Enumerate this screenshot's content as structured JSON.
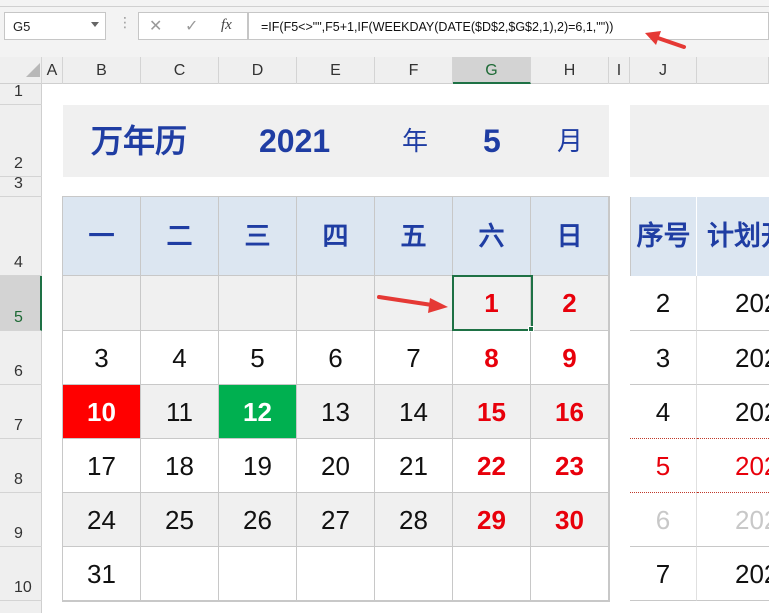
{
  "formula_bar": {
    "name_box": "G5",
    "cancel_icon": "✕",
    "enter_icon": "✓",
    "function_icon": "fx",
    "formula": "=IF(F5<>\"\",F5+1,IF(WEEKDAY(DATE($D$2,$G$2,1),2)=6,1,\"\"))"
  },
  "columns": [
    "A",
    "B",
    "C",
    "D",
    "E",
    "F",
    "G",
    "H",
    "I",
    "J"
  ],
  "rows": [
    "1",
    "2",
    "3",
    "4",
    "5",
    "6",
    "7",
    "8",
    "9",
    "10"
  ],
  "selected_cell": {
    "column": "G",
    "row": "5"
  },
  "header": {
    "title": "万年历",
    "year": "2021",
    "year_label": "年",
    "month": "5",
    "month_label": "月"
  },
  "weekdays": [
    "一",
    "二",
    "三",
    "四",
    "五",
    "六",
    "日"
  ],
  "weeks": [
    [
      "",
      "",
      "",
      "",
      "",
      "1",
      "2"
    ],
    [
      "3",
      "4",
      "5",
      "6",
      "7",
      "8",
      "9"
    ],
    [
      "10",
      "11",
      "12",
      "13",
      "14",
      "15",
      "16"
    ],
    [
      "17",
      "18",
      "19",
      "20",
      "21",
      "22",
      "23"
    ],
    [
      "24",
      "25",
      "26",
      "27",
      "28",
      "29",
      "30"
    ],
    [
      "31",
      "",
      "",
      "",
      "",
      "",
      ""
    ]
  ],
  "highlights": {
    "red_fill": "10",
    "green_fill": "12"
  },
  "plan_table": {
    "headers": [
      "序号",
      "计划开"
    ],
    "rows": [
      {
        "no": "2",
        "date": "202"
      },
      {
        "no": "3",
        "date": "202"
      },
      {
        "no": "4",
        "date": "202"
      },
      {
        "no": "5",
        "date": "202"
      },
      {
        "no": "6",
        "date": "202"
      },
      {
        "no": "7",
        "date": "202"
      }
    ]
  },
  "colors": {
    "title_blue": "#1f3da3",
    "weekend_red": "#e8000b",
    "highlight_red": "#ff0000",
    "highlight_green": "#00b050",
    "arrow_red": "#e53935",
    "selection_green": "#1e7145"
  }
}
